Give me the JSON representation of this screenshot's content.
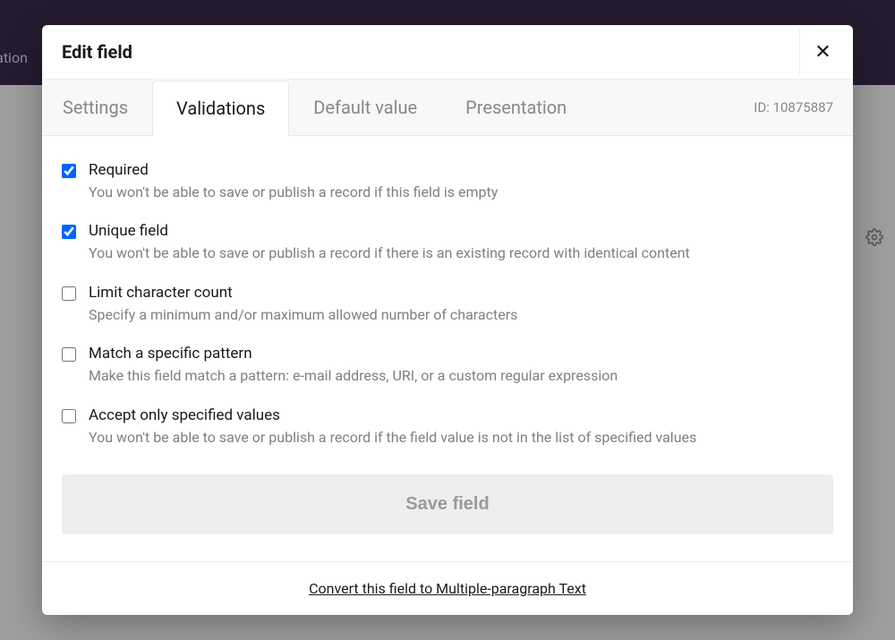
{
  "background": {
    "leftText": "ration"
  },
  "modal": {
    "title": "Edit field",
    "tabs": [
      {
        "label": "Settings"
      },
      {
        "label": "Validations"
      },
      {
        "label": "Default value"
      },
      {
        "label": "Presentation"
      }
    ],
    "idLabel": "ID: 10875887",
    "options": [
      {
        "title": "Required",
        "description": "You won't be able to save or publish a record if this field is empty",
        "checked": true
      },
      {
        "title": "Unique field",
        "description": "You won't be able to save or publish a record if there is an existing record with identical content",
        "checked": true
      },
      {
        "title": "Limit character count",
        "description": "Specify a minimum and/or maximum allowed number of characters",
        "checked": false
      },
      {
        "title": "Match a specific pattern",
        "description": "Make this field match a pattern: e-mail address, URI, or a custom regular expression",
        "checked": false
      },
      {
        "title": "Accept only specified values",
        "description": "You won't be able to save or publish a record if the field value is not in the list of specified values",
        "checked": false
      }
    ],
    "saveButton": "Save field",
    "convertLink": "Convert this field to Multiple-paragraph Text"
  }
}
